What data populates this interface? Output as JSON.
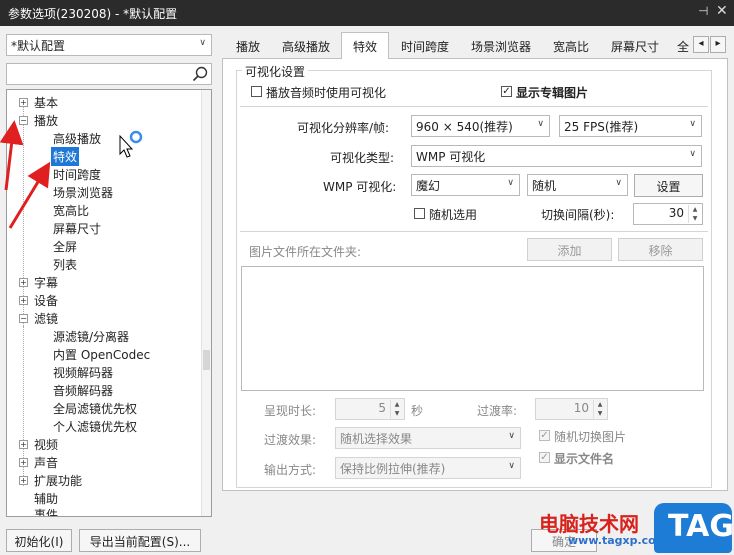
{
  "window": {
    "title": "参数选项(230208) - *默认配置",
    "pin": "⊣",
    "close": "✕"
  },
  "profile": {
    "selected": "*默认配置"
  },
  "search": {
    "value": ""
  },
  "tree": {
    "items": [
      {
        "label": "基本",
        "expander": "+"
      },
      {
        "label": "播放",
        "expander": "−"
      },
      {
        "label": "高级播放"
      },
      {
        "label": "特效"
      },
      {
        "label": "时间跨度"
      },
      {
        "label": "场景浏览器"
      },
      {
        "label": "宽高比"
      },
      {
        "label": "屏幕尺寸"
      },
      {
        "label": "全屏"
      },
      {
        "label": "列表"
      },
      {
        "label": "字幕",
        "expander": "+"
      },
      {
        "label": "设备",
        "expander": "+"
      },
      {
        "label": "滤镜",
        "expander": "−"
      },
      {
        "label": "源滤镜/分离器"
      },
      {
        "label": "内置 OpenCodec"
      },
      {
        "label": "视频解码器"
      },
      {
        "label": "音频解码器"
      },
      {
        "label": "全局滤镜优先权"
      },
      {
        "label": "个人滤镜优先权"
      },
      {
        "label": "视频",
        "expander": "+"
      },
      {
        "label": "声音",
        "expander": "+"
      },
      {
        "label": "扩展功能",
        "expander": "+"
      },
      {
        "label": "辅助"
      },
      {
        "label": "事件"
      }
    ]
  },
  "tabs": [
    "播放",
    "高级播放",
    "特效",
    "时间跨度",
    "场景浏览器",
    "宽高比",
    "屏幕尺寸",
    "全"
  ],
  "tab_scroll": {
    "left": "◂",
    "right": "▸"
  },
  "visual": {
    "group_title": "可视化设置",
    "use_visual_label": "播放音频时使用可视化",
    "use_visual_checked": "",
    "show_album_label": "显示专辑图片",
    "show_album_checked": "✓",
    "resolution_label": "可视化分辨率/帧:",
    "resolution_value": "960 × 540(推荐)",
    "fps_value": "25 FPS(推荐)",
    "type_label": "可视化类型:",
    "type_value": "WMP 可视化",
    "wmp_label": "WMP 可视化:",
    "wmp_value1": "魔幻",
    "wmp_value2": "随机",
    "settings_button": "设置",
    "random_label": "随机选用",
    "random_checked": "",
    "interval_label": "切换间隔(秒):",
    "interval_value": "30"
  },
  "folder": {
    "label": "图片文件所在文件夹:",
    "add_button": "添加",
    "remove_button": "移除"
  },
  "display": {
    "duration_label": "呈现时长:",
    "duration_value": "5",
    "duration_unit": "秒",
    "transition_rate_label": "过渡率:",
    "transition_rate_value": "10",
    "transition_effect_label": "过渡效果:",
    "transition_effect_value": "随机选择效果",
    "random_switch_label": "随机切换图片",
    "random_switch_checked": "✓",
    "output_label": "输出方式:",
    "output_value": "保持比例拉伸(推荐)",
    "show_filename_label": "显示文件名",
    "show_filename_checked": "✓"
  },
  "footer": {
    "init_button": "初始化(I)",
    "export_button": "导出当前配置(S)...",
    "confirm_button": "确定"
  },
  "watermark": {
    "site": "电脑技术网",
    "url": "www.tagxp.com",
    "tag": "TAG"
  },
  "arrow_color": "#e02020",
  "spinner_up": "▲",
  "spinner_down": "▼",
  "dropdown_arrow": "∨"
}
